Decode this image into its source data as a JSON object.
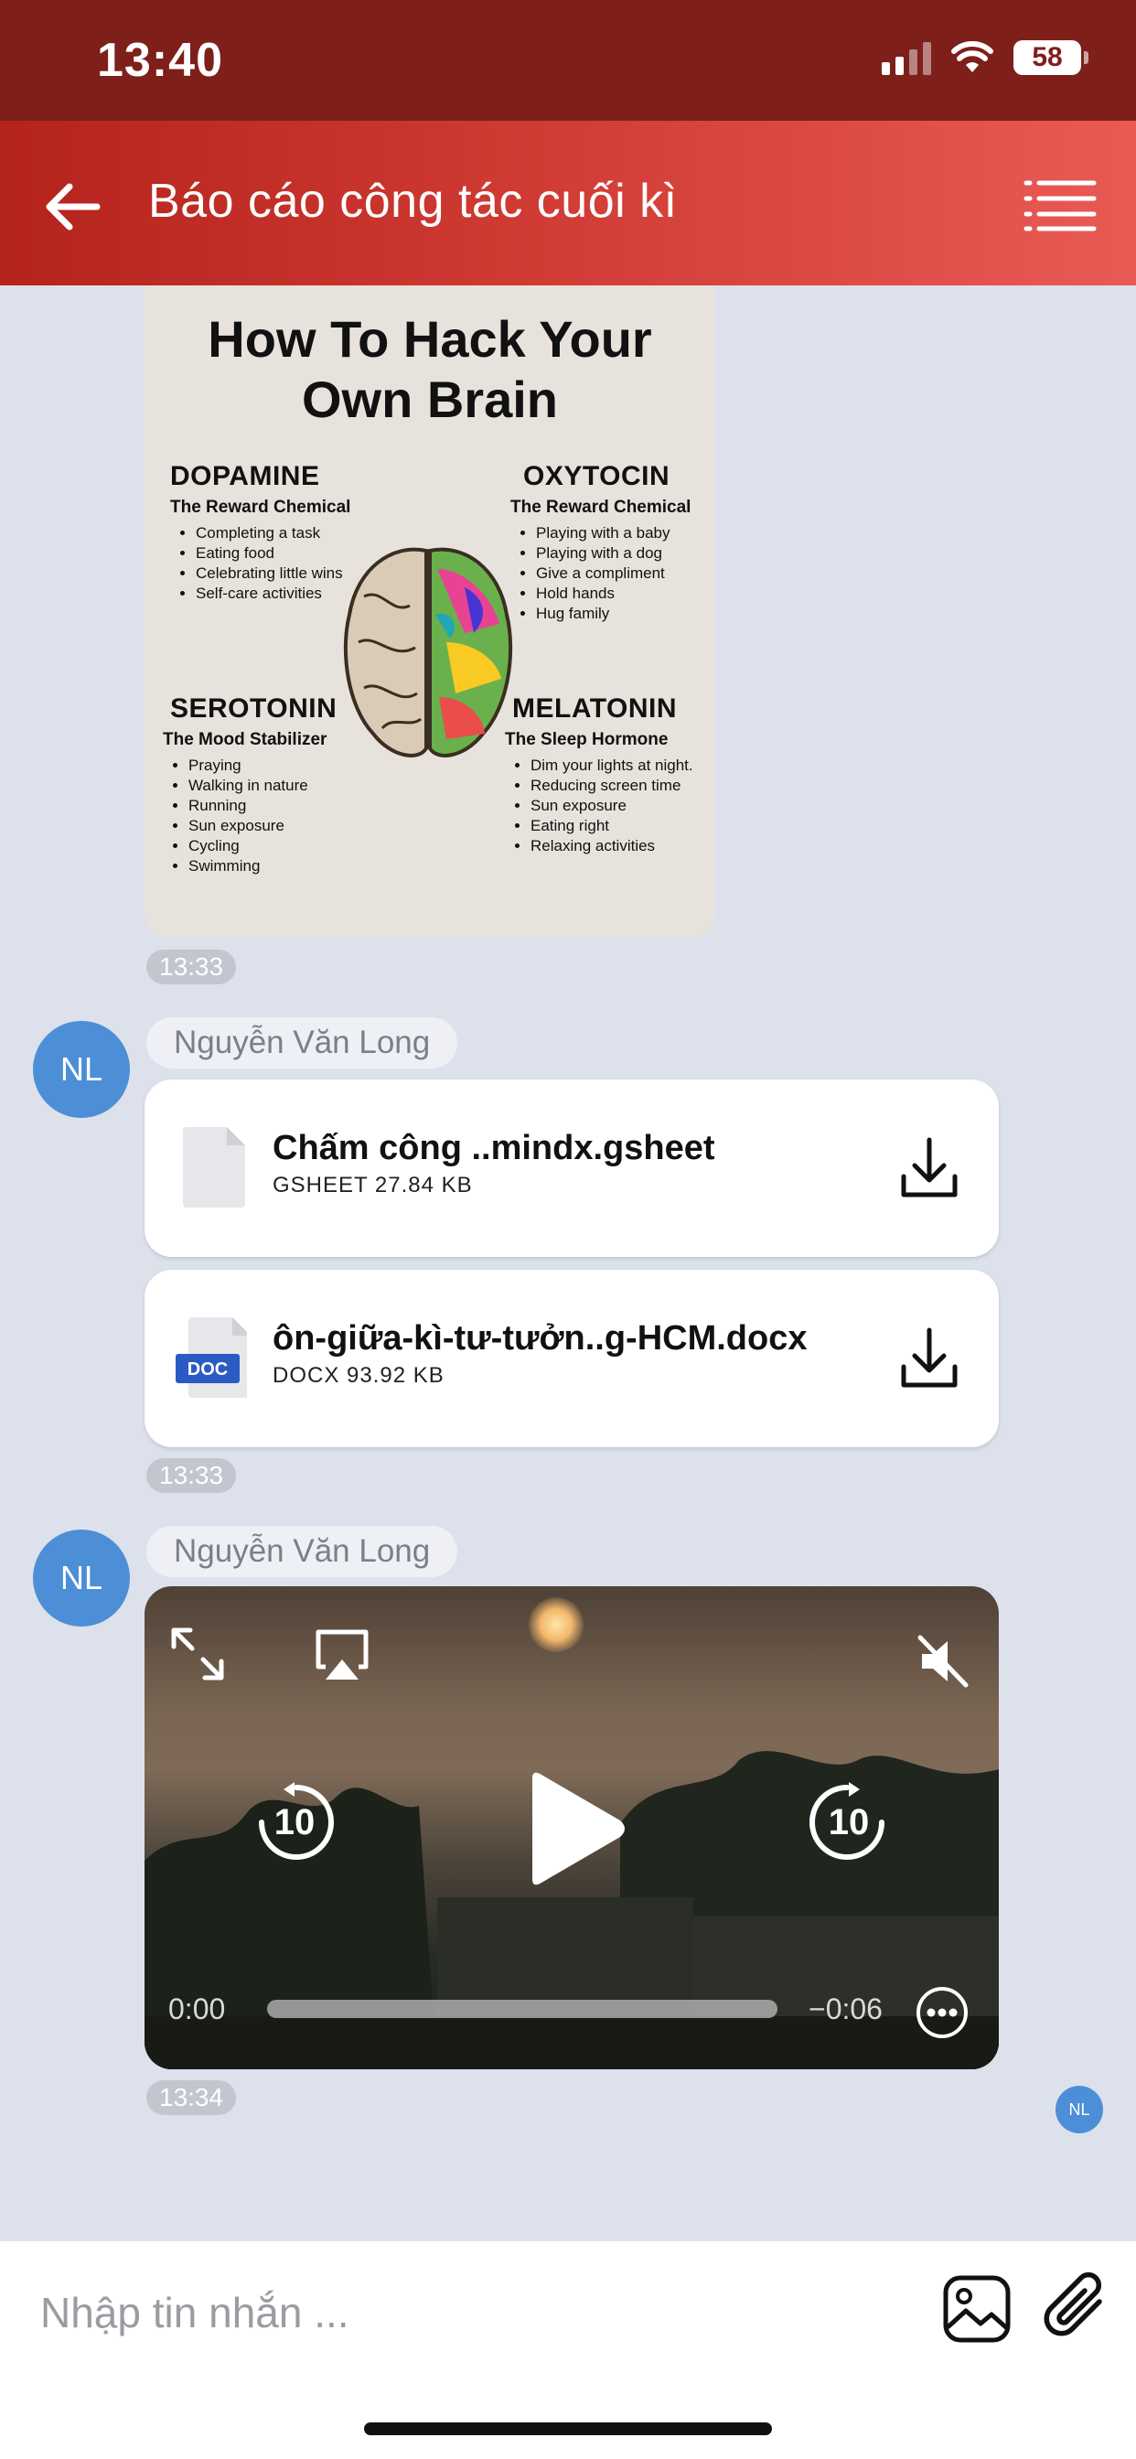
{
  "status_bar": {
    "time": "13:40",
    "battery": "58"
  },
  "header": {
    "title": "Báo cáo công tác cuối kì"
  },
  "image_message": {
    "title": "How To Hack Your Own Brain",
    "sections": [
      {
        "name": "DOPAMINE",
        "subtitle": "The Reward Chemical",
        "items": [
          "Completing a task",
          "Eating food",
          "Celebrating little wins",
          "Self-care activities"
        ]
      },
      {
        "name": "OXYTOCIN",
        "subtitle": "The Reward Chemical",
        "items": [
          "Playing with a baby",
          "Playing with a dog",
          "Give a compliment",
          "Hold hands",
          "Hug family"
        ]
      },
      {
        "name": "SEROTONIN",
        "subtitle": "The Mood Stabilizer",
        "items": [
          "Praying",
          "Walking in nature",
          "Running",
          "Sun exposure",
          "Cycling",
          "Swimming"
        ]
      },
      {
        "name": "MELATONIN",
        "subtitle": "The Sleep Hormone",
        "items": [
          "Dim your lights at night.",
          "Reducing screen time",
          "Sun exposure",
          "Eating right",
          "Relaxing activities"
        ]
      }
    ],
    "time": "13:33"
  },
  "file_group": {
    "avatar": "NL",
    "sender": "Nguyễn Văn Long",
    "files": [
      {
        "name": "Chấm công ..mindx.gsheet",
        "meta": "GSHEET 27.84 KB",
        "icon": "blank-file-icon"
      },
      {
        "name": "ôn-giữa-kì-tư-tưởn..g-HCM.docx",
        "meta": "DOCX 93.92 KB",
        "icon": "doc-file-icon",
        "badge": "DOC"
      }
    ],
    "time": "13:33"
  },
  "video_group": {
    "avatar": "NL",
    "sender": "Nguyễn Văn Long",
    "video": {
      "elapsed": "0:00",
      "remaining": "−0:06",
      "skip_seconds": "10"
    },
    "time": "13:34"
  },
  "read_receipt": {
    "avatar": "NL"
  },
  "composer": {
    "placeholder": "Nhập tin nhắn ..."
  },
  "colors": {
    "status_bar": "#7e1f1a",
    "header_start": "#b4231c",
    "header_end": "#ea5a55",
    "background": "#dde1ec",
    "avatar": "#4d8fd6"
  }
}
